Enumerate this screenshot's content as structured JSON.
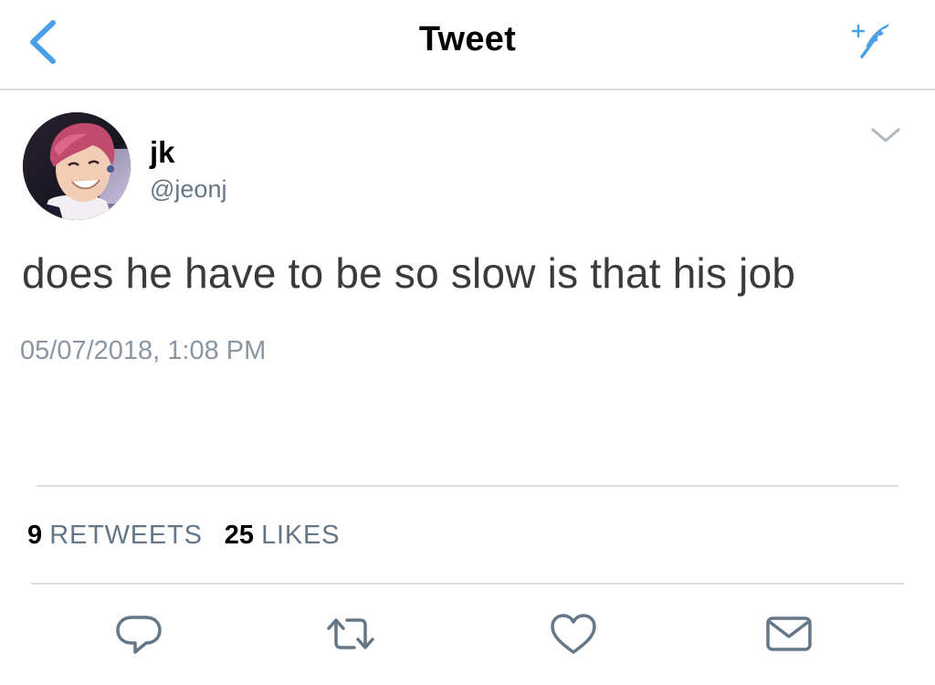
{
  "header": {
    "title": "Tweet",
    "back_icon": "chevron-left-icon",
    "compose_icon": "sparkle-feather-icon",
    "accent_color": "#4a9fe8"
  },
  "tweet": {
    "author_name": "jk",
    "author_handle": "@jeonj",
    "text": "does he have to be so slow is that his job",
    "timestamp": "05/07/2018, 1:08 PM",
    "avatar": "profile-photo",
    "more_icon": "chevron-down-icon"
  },
  "stats": {
    "retweets_count": "9",
    "retweets_label": "RETWEETS",
    "likes_count": "25",
    "likes_label": "LIKES"
  },
  "actions": {
    "reply_icon": "reply-icon",
    "retweet_icon": "retweet-icon",
    "like_icon": "heart-icon",
    "share_icon": "mail-icon",
    "icon_color": "#657786"
  }
}
